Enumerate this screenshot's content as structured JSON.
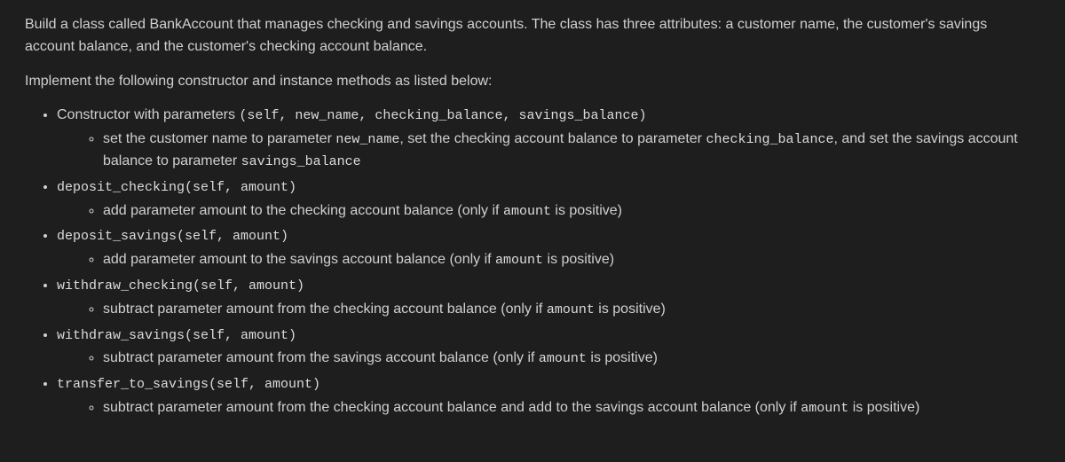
{
  "intro": {
    "p1": "Build a class called BankAccount that manages checking and savings accounts. The class has three attributes: a customer name, the customer's savings account balance, and the customer's checking account balance.",
    "p2": "Implement the following constructor and instance methods as listed below:"
  },
  "items": [
    {
      "lead": "Constructor with parameters ",
      "sig": "(self, new_name, checking_balance, savings_balance)",
      "desc_parts": [
        {
          "t": "text",
          "v": "set the customer name to parameter "
        },
        {
          "t": "code",
          "v": "new_name"
        },
        {
          "t": "text",
          "v": ", set the checking account balance to parameter "
        },
        {
          "t": "code",
          "v": "checking_balance"
        },
        {
          "t": "text",
          "v": ", and set the savings account balance to parameter "
        },
        {
          "t": "code",
          "v": "savings_balance"
        }
      ]
    },
    {
      "lead": "",
      "sig": "deposit_checking(self, amount)",
      "desc_parts": [
        {
          "t": "text",
          "v": "add parameter amount to the checking account balance (only if "
        },
        {
          "t": "code",
          "v": "amount"
        },
        {
          "t": "text",
          "v": " is positive)"
        }
      ]
    },
    {
      "lead": "",
      "sig": "deposit_savings(self, amount)",
      "desc_parts": [
        {
          "t": "text",
          "v": "add parameter amount to the savings account balance (only if "
        },
        {
          "t": "code",
          "v": "amount"
        },
        {
          "t": "text",
          "v": " is positive)"
        }
      ]
    },
    {
      "lead": "",
      "sig": "withdraw_checking(self, amount)",
      "desc_parts": [
        {
          "t": "text",
          "v": "subtract parameter amount from the checking account balance (only if "
        },
        {
          "t": "code",
          "v": "amount"
        },
        {
          "t": "text",
          "v": " is positive)"
        }
      ]
    },
    {
      "lead": "",
      "sig": "withdraw_savings(self, amount)",
      "desc_parts": [
        {
          "t": "text",
          "v": "subtract parameter amount from the savings account balance (only if "
        },
        {
          "t": "code",
          "v": "amount"
        },
        {
          "t": "text",
          "v": " is positive)"
        }
      ]
    },
    {
      "lead": "",
      "sig": "transfer_to_savings(self, amount)",
      "desc_parts": [
        {
          "t": "text",
          "v": "subtract parameter amount from the checking account balance and add to the savings account balance (only if "
        },
        {
          "t": "code",
          "v": "amount"
        },
        {
          "t": "text",
          "v": " is positive)"
        }
      ]
    }
  ]
}
